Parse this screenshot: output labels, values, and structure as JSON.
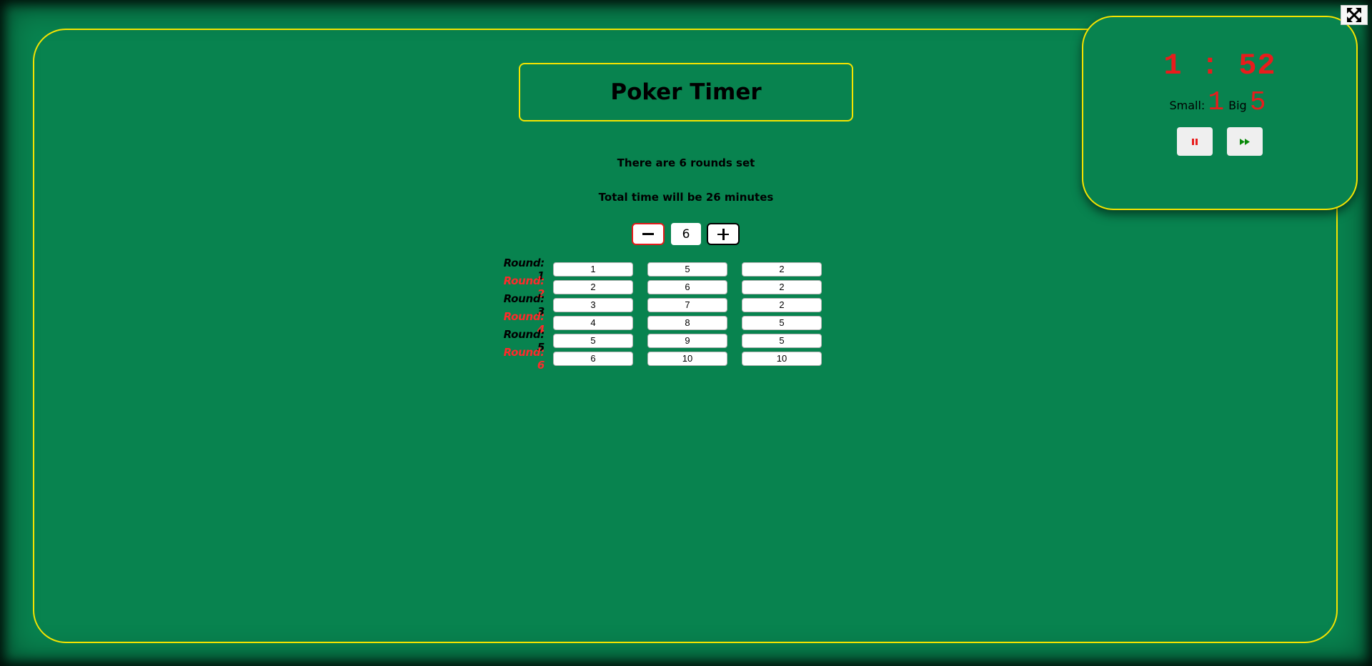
{
  "page": {
    "title": "Poker Timer",
    "rounds_info": "There are 6 rounds set",
    "total_info": "Total time will be 26 minutes"
  },
  "stepper": {
    "value": "6",
    "minus_icon": "minus-icon",
    "plus_icon": "plus-icon"
  },
  "rounds": [
    {
      "label": "Round: 1",
      "small": "1",
      "big": "5",
      "minutes": "2"
    },
    {
      "label": "Round: 2",
      "small": "2",
      "big": "6",
      "minutes": "2"
    },
    {
      "label": "Round: 3",
      "small": "3",
      "big": "7",
      "minutes": "2"
    },
    {
      "label": "Round: 4",
      "small": "4",
      "big": "8",
      "minutes": "5"
    },
    {
      "label": "Round: 5",
      "small": "5",
      "big": "9",
      "minutes": "5"
    },
    {
      "label": "Round: 6",
      "small": "6",
      "big": "10",
      "minutes": "10"
    }
  ],
  "timer": {
    "display": "1 : 52",
    "small_label": "Small:",
    "small_value": "1",
    "big_label": "Big",
    "big_value": "5",
    "pause_icon": "pause-icon",
    "skip_icon": "fast-forward-icon"
  },
  "fullscreen": {
    "icon": "fullscreen-icon"
  },
  "colors": {
    "felt": "#08834f",
    "border": "#f5e400",
    "accent_red": "#e81c1c",
    "label_red": "#ff2a2a",
    "skip_green": "#0a8a0a"
  }
}
